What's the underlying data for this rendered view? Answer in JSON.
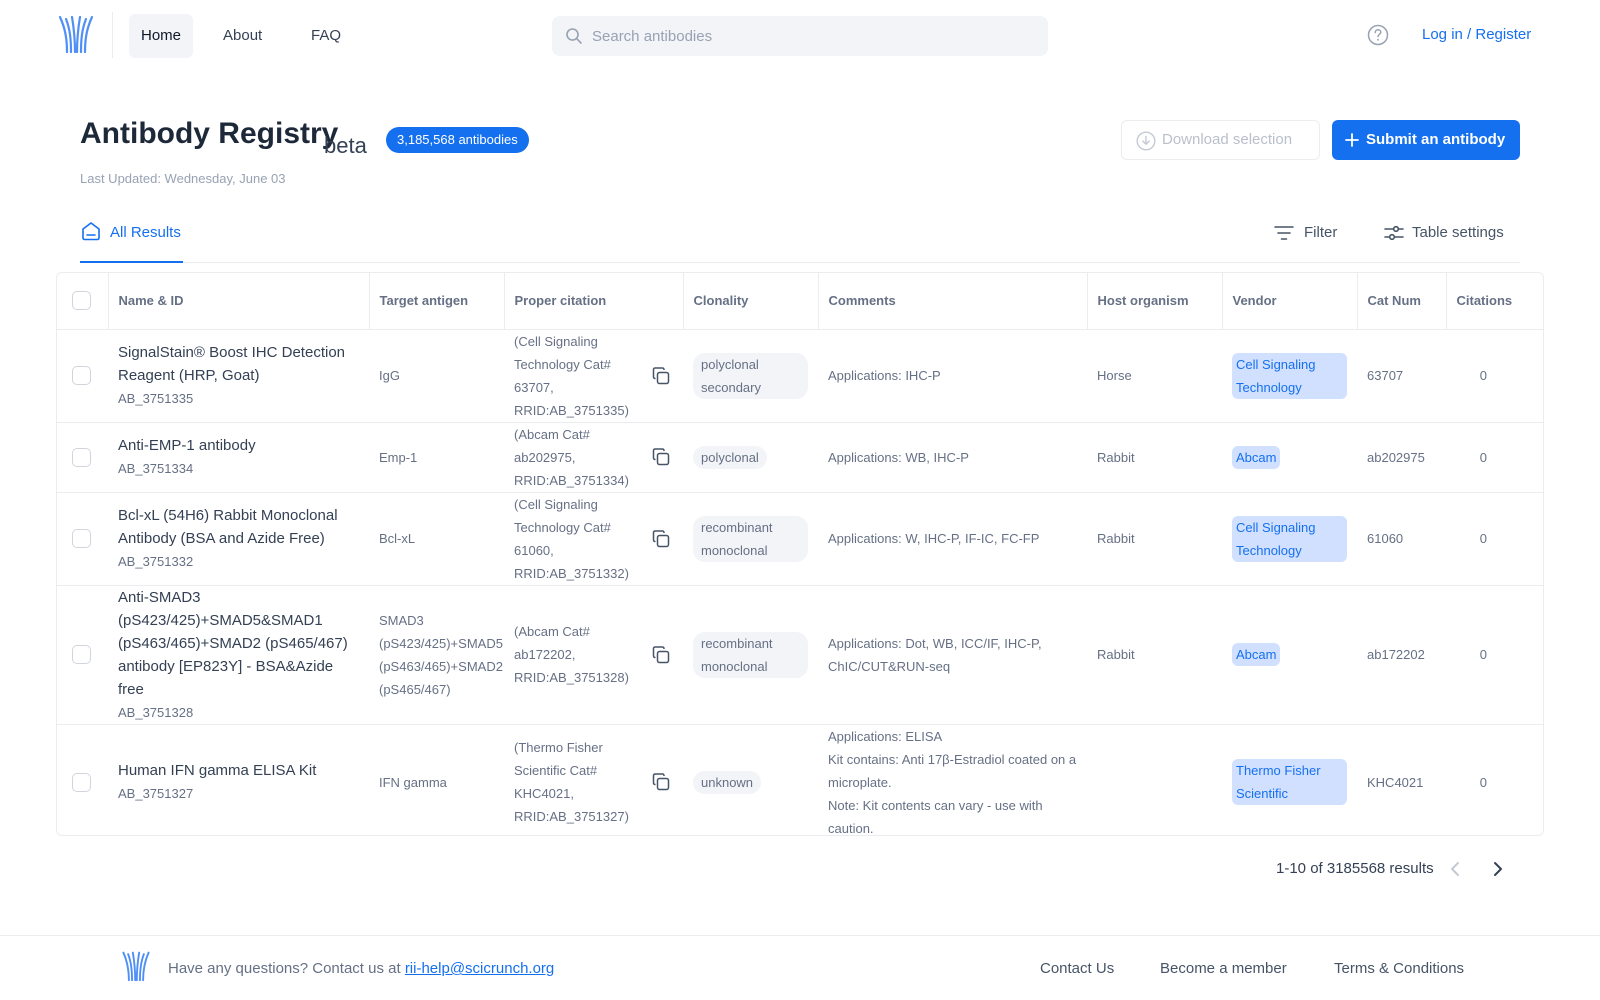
{
  "nav": {
    "logo_icon": "registry-logo-icon",
    "links": [
      "Home",
      "About",
      "FAQ"
    ],
    "active": "Home",
    "search_placeholder": "Search antibodies",
    "login_label": "Log in / Register",
    "help_icon": "question-circle-icon"
  },
  "header": {
    "title": "Antibody Registry",
    "beta": "beta",
    "count_badge": "3,185,568 antibodies",
    "last_updated": "Last Updated: Wednesday, June 03",
    "download_label": "Download selection",
    "submit_label": "Submit an antibody"
  },
  "tabs": {
    "all_results": "All Results",
    "filter": "Filter",
    "table_settings": "Table settings"
  },
  "table": {
    "columns": [
      "Name & ID",
      "Target antigen",
      "Proper citation",
      "Clonality",
      "Comments",
      "Host organism",
      "Vendor",
      "Cat Num",
      "Citations"
    ],
    "rows": [
      {
        "name": "SignalStain® Boost IHC Detection Reagent (HRP, Goat)",
        "id": "AB_3751335",
        "target": "IgG",
        "citation": "(Cell Signaling Technology Cat# 63707, RRID:AB_3751335)",
        "clonality": "polyclonal secondary",
        "comments": "Applications: IHC-P",
        "host": "Horse",
        "vendor": "Cell Signaling Technology",
        "cat": "63707",
        "citations": "0"
      },
      {
        "name": "Anti-EMP-1 antibody",
        "id": "AB_3751334",
        "target": "Emp-1",
        "citation": "(Abcam Cat# ab202975, RRID:AB_3751334)",
        "clonality": "polyclonal",
        "comments": "Applications: WB, IHC-P",
        "host": "Rabbit",
        "vendor": "Abcam",
        "cat": "ab202975",
        "citations": "0"
      },
      {
        "name": "Bcl-xL (54H6) Rabbit Monoclonal Antibody (BSA and Azide Free)",
        "id": "AB_3751332",
        "target": "Bcl-xL",
        "citation": "(Cell Signaling Technology Cat# 61060, RRID:AB_3751332)",
        "clonality": "recombinant monoclonal",
        "comments": "Applications: W, IHC-P, IF-IC, FC-FP",
        "host": "Rabbit",
        "vendor": "Cell Signaling Technology",
        "cat": "61060",
        "citations": "0"
      },
      {
        "name": "Anti-SMAD3 (pS423/425)+SMAD5&SMAD1 (pS463/465)+SMAD2 (pS465/467) antibody [EP823Y] - BSA&Azide free",
        "id": "AB_3751328",
        "target_lines": [
          "SMAD3",
          "(pS423/425)+SMAD5",
          "(pS463/465)+SMAD2",
          "(pS465/467)"
        ],
        "citation": "(Abcam Cat# ab172202, RRID:AB_3751328)",
        "clonality": "recombinant monoclonal",
        "comments": "Applications: Dot, WB, ICC/IF, IHC-P, ChIC/CUT&RUN-seq",
        "host": "Rabbit",
        "vendor": "Abcam",
        "cat": "ab172202",
        "citations": "0"
      },
      {
        "name": "Human IFN gamma ELISA Kit",
        "id": "AB_3751327",
        "target": "IFN gamma",
        "citation": "(Thermo Fisher Scientific Cat# KHC4021, RRID:AB_3751327)",
        "clonality": "unknown",
        "comments_lines": [
          "Applications: ELISA",
          "Kit contains: Anti 17β-Estradiol coated on a microplate.",
          "Note: Kit contents can vary - use with caution."
        ],
        "host": "",
        "vendor": "Thermo Fisher Scientific",
        "cat": "KHC4021",
        "citations": "0"
      }
    ]
  },
  "pagination": {
    "summary": "1-10 of 3185568 results"
  },
  "footer": {
    "question": "Have any questions? Contact us at ",
    "email": "rii-help@scicrunch.org",
    "links": [
      "Contact Us",
      "Become a member",
      "Terms & Conditions"
    ]
  },
  "colors": {
    "accent": "#1570ef",
    "vendor_bg": "#d1e0ff",
    "pill_bg": "#f2f4f7",
    "border": "#eaecf0"
  }
}
